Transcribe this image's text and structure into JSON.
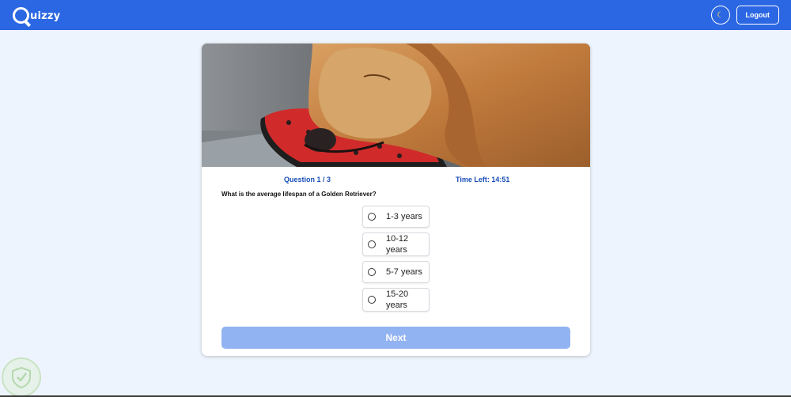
{
  "app": {
    "logo_text": "uizzy",
    "logout_label": "Logout",
    "theme_icon": "moon-icon"
  },
  "quiz": {
    "question_counter": "Question 1 / 3",
    "time_left": "Time Left: 14:51",
    "question_text": "What is the average lifespan of a Golden Retriever?",
    "image_subject": "golden-retriever-photo",
    "options": [
      {
        "label": "1-3 years",
        "selected": false
      },
      {
        "label": "10-12 years",
        "selected": false
      },
      {
        "label": "5-7 years",
        "selected": false
      },
      {
        "label": "15-20 years",
        "selected": false
      }
    ],
    "next_label": "Next"
  },
  "colors": {
    "header": "#2b67e3",
    "background": "#eef4fd",
    "accent_text": "#1a4fb8",
    "next_disabled": "#92b3f2"
  }
}
